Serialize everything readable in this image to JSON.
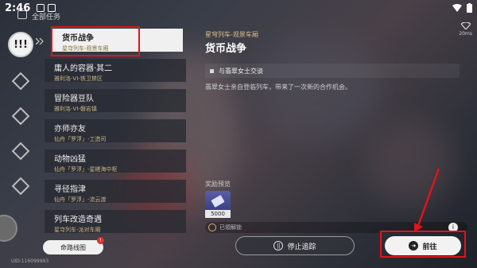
{
  "status": {
    "time": "2:46"
  },
  "header": {
    "title": "全部任务"
  },
  "rail": {
    "active_label": "!!!"
  },
  "quests": [
    {
      "title": "货币战争",
      "location": "星穹列车-观景车厢",
      "active": true
    },
    {
      "title": "庸人的容器·其二",
      "location": "雅利洛-VI-铁卫禁区"
    },
    {
      "title": "冒险器豆队",
      "location": "雅利洛-VI-磐岩镇"
    },
    {
      "title": "亦师亦友",
      "location": "仙舟「罗浮」-工造司"
    },
    {
      "title": "动物凶猛",
      "location": "仙舟「罗浮」-星槎海中枢"
    },
    {
      "title": "寻径指津",
      "location": "仙舟「罗浮」-流云渡"
    },
    {
      "title": "列车改造奇遇",
      "location": "星穹列车-派对车厢"
    }
  ],
  "detail": {
    "location": "星穹列车-观景车厢",
    "title": "货币战争",
    "objective": "与翡翠女士交谈",
    "description": "翡翠女士亲自登临列车，带来了一次新的合作机会。",
    "reward_label": "奖励预览",
    "reward_amount": "5000",
    "note": "已領解锁"
  },
  "network": {
    "latency": "20ms"
  },
  "buttons": {
    "map": "命路线图",
    "stop": "停止追踪",
    "go": "前往",
    "badge": "!"
  },
  "uid": "UID:116099993"
}
